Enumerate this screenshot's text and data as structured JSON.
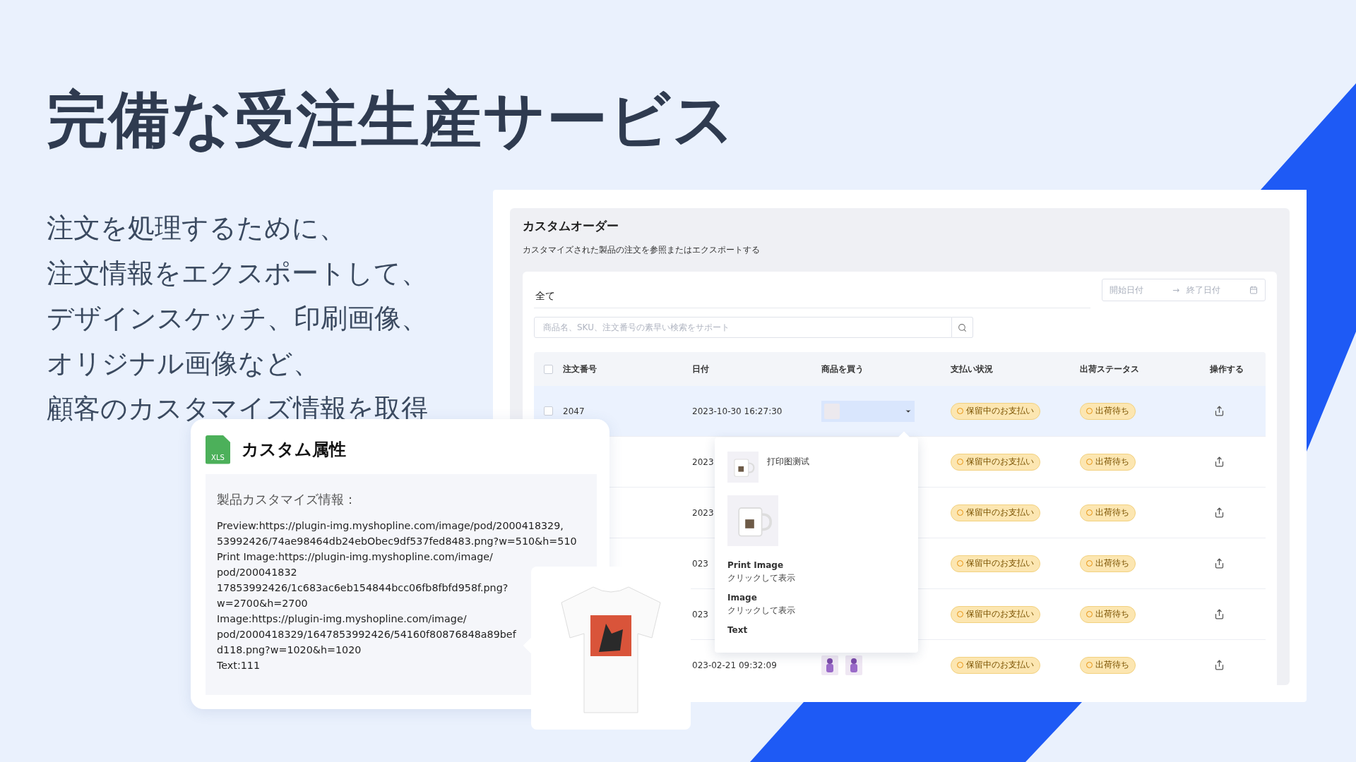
{
  "headline": "完備な受注生産サービス",
  "intro_lines": [
    "注文を処理するために、",
    "注文情報をエクスポートして、",
    "デザインスケッチ、印刷画像、",
    "オリジナル画像など、",
    "顧客のカスタマイズ情報を取得"
  ],
  "orders_window": {
    "title": "カスタムオーダー",
    "subtitle": "カスタマイズされた製品の注文を参照またはエクスポートする",
    "tabs": [
      {
        "label": "全て",
        "selected": true
      }
    ],
    "date_range": {
      "start_placeholder": "開始日付",
      "separator": "→",
      "end_placeholder": "終了日付"
    },
    "search": {
      "placeholder": "商品名、SKU、注文番号の素早い検索をサポート"
    },
    "table": {
      "header_checked": false,
      "columns": [
        "注文番号",
        "日付",
        "商品を買う",
        "支払い状況",
        "出荷ステータス",
        "操作する"
      ],
      "rows": [
        {
          "selected": true,
          "checked": false,
          "order": "2047",
          "date": "2023-10-30 16:27:30",
          "kind": "dropdown",
          "payment": "保留中のお支払い",
          "shipping": "出荷待ち"
        },
        {
          "selected": false,
          "date": "2023",
          "kind": "plain",
          "payment": "保留中のお支払い",
          "shipping": "出荷待ち"
        },
        {
          "selected": false,
          "date": "2023",
          "kind": "plain",
          "payment": "保留中のお支払い",
          "shipping": "出荷待ち"
        },
        {
          "selected": false,
          "date": "023",
          "kind": "plain",
          "payment": "保留中のお支払い",
          "shipping": "出荷待ち"
        },
        {
          "selected": false,
          "date": "023",
          "kind": "plain",
          "payment": "保留中のお支払い",
          "shipping": "出荷待ち"
        },
        {
          "selected": false,
          "date": "023-02-21 09:32:09",
          "kind": "figures",
          "payment": "保留中のお支払い",
          "shipping": "出荷待ち"
        }
      ]
    },
    "product_popup": {
      "caption": "打印图测试",
      "fields": [
        {
          "label": "Print Image",
          "value": "クリックして表示"
        },
        {
          "label": "Image",
          "value": "クリックして表示"
        },
        {
          "label": "Text"
        }
      ]
    }
  },
  "attributes_card": {
    "file_badge": "XLS",
    "title": "カスタム属性",
    "heading": "製品カスタマイズ情報：",
    "lines": [
      "Preview:https://plugin-img.myshopline.com/image/pod/2000418329,",
      "53992426/74ae98464db24ebObec9df537fed8483.png?w=510&h=510",
      "Print Image:https://plugin-img.myshopline.com/image/",
      "pod/200041832",
      "17853992426/1c683ac6eb154844bcc06fb8fbfd958f.png?",
      "w=2700&h=2700",
      "Image:https://plugin-img.myshopline.com/image/",
      "pod/2000418329/1647853992426/54160f80876848a89bef",
      "d118.png?w=1020&h=1020",
      "Text:111"
    ]
  }
}
